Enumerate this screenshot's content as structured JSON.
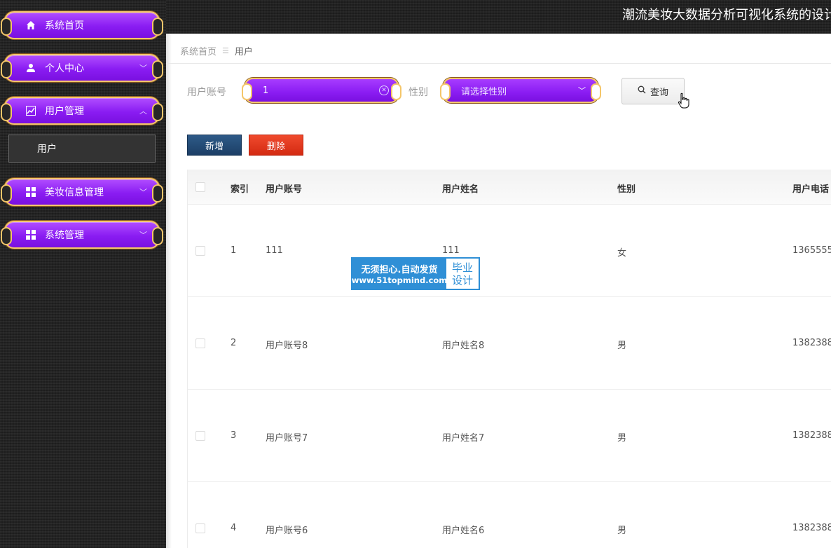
{
  "header": {
    "title": "潮流美妆大数据分析可视化系统的设计"
  },
  "sidebar": {
    "items": [
      {
        "label": "系统首页",
        "icon": "home-icon",
        "arrow": ""
      },
      {
        "label": "个人中心",
        "icon": "user-icon",
        "arrow": "﹀"
      },
      {
        "label": "用户管理",
        "icon": "chart-icon",
        "arrow": "︿"
      },
      {
        "label": "美妆信息管理",
        "icon": "grid-icon",
        "arrow": "﹀"
      },
      {
        "label": "系统管理",
        "icon": "grid-icon",
        "arrow": "﹀"
      }
    ],
    "submenu": {
      "label": "用户"
    }
  },
  "breadcrumb": {
    "home": "系统首页",
    "separator": "☰",
    "current": "用户"
  },
  "search": {
    "account_label": "用户账号",
    "account_value": "1",
    "gender_label": "性别",
    "gender_placeholder": "请选择性别",
    "query_label": "查询"
  },
  "actions": {
    "add_label": "新增",
    "delete_label": "删除"
  },
  "table": {
    "columns": [
      "索引",
      "用户账号",
      "用户姓名",
      "性别",
      "用户电话"
    ],
    "rows": [
      {
        "index": "1",
        "account": "111",
        "name": "111",
        "gender": "女",
        "phone": "1365555"
      },
      {
        "index": "2",
        "account": "用户账号8",
        "name": "用户姓名8",
        "gender": "男",
        "phone": "1382388"
      },
      {
        "index": "3",
        "account": "用户账号7",
        "name": "用户姓名7",
        "gender": "男",
        "phone": "1382388"
      },
      {
        "index": "4",
        "account": "用户账号6",
        "name": "用户姓名6",
        "gender": "男",
        "phone": "1382388"
      }
    ]
  },
  "watermark": {
    "line1": "无须担心.自动发货",
    "line2": "www.51topmind.com",
    "right_top": "毕业",
    "right_bottom": "设计"
  },
  "colors": {
    "menu_purple": "#8a1cf2",
    "menu_border_gold": "#f4c66a",
    "sidebar_bg": "#272727",
    "add_button": "#1c3f66",
    "delete_button": "#d42a12",
    "watermark_blue": "#2f8fd6"
  }
}
